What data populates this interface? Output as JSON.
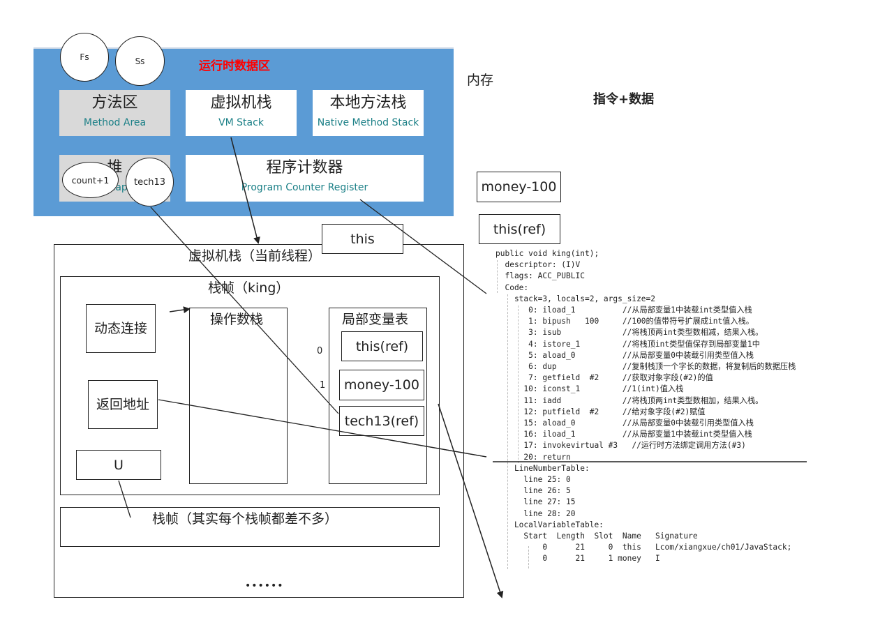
{
  "runtime_area": {
    "title": "运行时数据区",
    "method_area": {
      "zh": "方法区",
      "en": "Method Area"
    },
    "vm_stack": {
      "zh": "虚拟机栈",
      "en": "VM Stack"
    },
    "native_stack": {
      "zh": "本地方法栈",
      "en": "Native Method Stack"
    },
    "heap": {
      "zh": "堆",
      "en": "Heap"
    },
    "pc_register": {
      "zh": "程序计数器",
      "en": "Program Counter Register"
    }
  },
  "circles": {
    "fs": "Fs",
    "ss": "Ss",
    "count": "count+1",
    "tech13": "tech13"
  },
  "labels": {
    "memory": "内存",
    "instr_data": "指令+数据",
    "money_top": "money-100",
    "this_ref_top": "this(ref)",
    "this_float": "this"
  },
  "vm_stack_thread": {
    "title": "虚拟机栈（当前线程）",
    "frame_title": "栈帧（king）",
    "dynamic_link": "动态连接",
    "return_addr": "返回地址",
    "u_box": "U",
    "operand_stack": "操作数栈",
    "local_vars": "局部变量表",
    "slot_0": "0",
    "slot_1": "1",
    "lv_this": "this(ref)",
    "lv_money": "money-100",
    "lv_tech13": "tech13(ref)",
    "next_frame": "栈帧（其实每个栈帧都差不多）",
    "ellipsis": "••••••"
  },
  "bytecode": {
    "lines": [
      "public void king(int);",
      "  descriptor: (I)V",
      "  flags: ACC_PUBLIC",
      "  Code:",
      "    stack=3, locals=2, args_size=2",
      "       0: iload_1          //从局部变量1中装载int类型值入栈",
      "       1: bipush   100     //100的值带符号扩展成int值入栈。",
      "       3: isub             //将栈顶两int类型数相减，结果入栈。",
      "       4: istore_1         //将栈顶int类型值保存到局部变量1中",
      "       5: aload_0          //从局部变量0中装载引用类型值入栈",
      "       6: dup              //复制栈顶一个字长的数据，将复制后的数据压栈",
      "       7: getfield  #2     //获取对象字段(#2)的值",
      "      10: iconst_1         //1(int)值入栈",
      "      11: iadd             //将栈顶两int类型数相加，结果入栈。",
      "      12: putfield  #2     //给对象字段(#2)赋值",
      "      15: aload_0          //从局部变量0中装载引用类型值入栈",
      "      16: iload_1          //从局部变量1中装载int类型值入栈",
      "      17: invokevirtual #3   //运行时方法绑定调用方法(#3)",
      "      20: return",
      "    LineNumberTable:",
      "      line 25: 0",
      "      line 26: 5",
      "      line 27: 15",
      "      line 28: 20",
      "    LocalVariableTable:",
      "      Start  Length  Slot  Name   Signature",
      "          0      21     0  this   Lcom/xiangxue/ch01/JavaStack;",
      "          0      21     1 money   I"
    ]
  }
}
